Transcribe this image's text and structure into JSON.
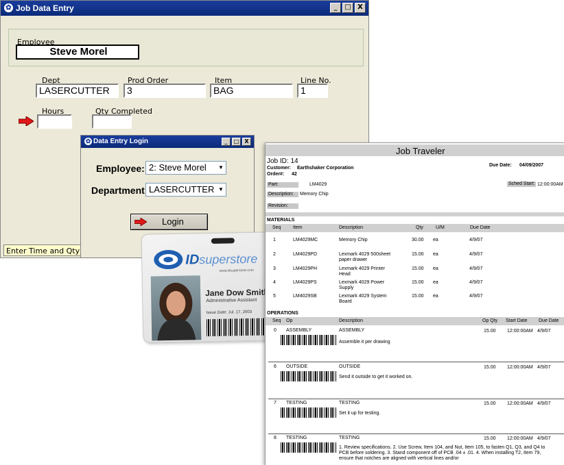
{
  "main_window": {
    "title": "Job Data Entry",
    "employee_label": "Employee",
    "employee_name": "Steve Morel",
    "dept_label": "Dept",
    "dept_value": "LASERCUTTER",
    "prod_order_label": "Prod Order",
    "prod_order_value": "3",
    "item_label": "Item",
    "item_value": "BAG",
    "line_no_label": "Line No.",
    "line_no_value": "1",
    "hours_label": "Hours",
    "hours_value": "",
    "qty_completed_label": "Qty Completed",
    "qty_completed_value": "",
    "status_text": "Enter Time and Qty",
    "window_buttons": [
      "_",
      "□",
      "X"
    ]
  },
  "login_dialog": {
    "title": "Data Entry Login",
    "employee_label": "Employee:",
    "employee_value": "2: Steve Morel",
    "department_label": "Department:",
    "department_value": "LASERCUTTER",
    "login_button": "Login"
  },
  "id_card": {
    "brand_prefix": "ID",
    "brand_suffix": "superstore",
    "website": "www.idsuperstore.com",
    "name": "Jane Dow Smith",
    "role": "Administrative Assistant",
    "issue_date": "Issue Date:  Jul. 17, 2003"
  },
  "traveler": {
    "title": "Job Traveler",
    "job_id": "Job ID:  14",
    "due_date_label": "Due Date:",
    "due_date": "04/09/2007",
    "customer_label": "Customer:",
    "customer": "Earthshaker Corporation",
    "order_label": "Order#:",
    "order": "42",
    "sched_start_label": "Sched Start:",
    "sched_start": "12:00:00AM",
    "part_label": "Part:",
    "part": "LM4029",
    "description_label": "Description:",
    "description": "Memory Chip",
    "revision_label": "Revision:",
    "materials_heading": "MATERIALS",
    "materials_columns": [
      "Seq",
      "Item",
      "Description",
      "Qty",
      "U/M",
      "Due Date"
    ],
    "materials": [
      {
        "seq": "1",
        "item": "LM4029MC",
        "desc": "Memory Chip",
        "desc2": "",
        "qty": "30.00",
        "um": "ea",
        "due": "4/9/07"
      },
      {
        "seq": "2",
        "item": "LM4029PD",
        "desc": "Lexmark 4029 500sheet",
        "desc2": "paper drawer",
        "qty": "15.00",
        "um": "ea",
        "due": "4/9/07"
      },
      {
        "seq": "3",
        "item": "LM4029PH",
        "desc": "Lexmark 4029 Printer",
        "desc2": "Head",
        "qty": "15.00",
        "um": "ea",
        "due": "4/9/07"
      },
      {
        "seq": "4",
        "item": "LM4029PS",
        "desc": "Lexmark 4029 Power",
        "desc2": "Supply",
        "qty": "15.00",
        "um": "ea",
        "due": "4/9/07"
      },
      {
        "seq": "5",
        "item": "LM4029SB",
        "desc": "Lexmark 4029 System",
        "desc2": "Board",
        "qty": "15.00",
        "um": "ea",
        "due": "4/9/07"
      }
    ],
    "operations_heading": "OPERATIONS",
    "operations_columns": [
      "Seq",
      "Op",
      "Description",
      "Op Qty",
      "Start Date",
      "Due Date"
    ],
    "operations": [
      {
        "seq": "0",
        "op": "ASSEMBLY",
        "desc": "ASSEMBLY",
        "qty": "15.00",
        "start": "12:00:00AM",
        "due": "4/9/07",
        "note": "Assemble it per drawing",
        "note2": "",
        "note3": ""
      },
      {
        "seq": "6",
        "op": "OUTSIDE",
        "desc": "OUTSIDE",
        "qty": "15.00",
        "start": "12:00:00AM",
        "due": "4/9/07",
        "note": "Send it outside to get it worked on.",
        "note2": "",
        "note3": ""
      },
      {
        "seq": "7",
        "op": "TESTING",
        "desc": "TESTING",
        "qty": "15.00",
        "start": "12:00:00AM",
        "due": "4/9/07",
        "note": "Set it up for testing.",
        "note2": "",
        "note3": ""
      },
      {
        "seq": "8",
        "op": "TESTING",
        "desc": "TESTING",
        "qty": "15.00",
        "start": "12:00:00AM",
        "due": "4/9/07",
        "note": "1. Review specifications. 2.  Use Screw, Item 104, and Nut, Item 105, to fasten Q1, Q3, and Q4 to",
        "note2": "PCB before soldering. 3.  Stand component off of PCB .04 ± .01. 4.  When installing T2, Item 79,",
        "note3": "ensure that notches are aligned with vertical lines and/or"
      }
    ]
  },
  "colors": {
    "titlebar": "#0b2a7a",
    "window_bg": "#ece9d8",
    "arrow": "#e01818",
    "status_bg": "#fffccc",
    "brand_blue": "#1f5fb0"
  }
}
